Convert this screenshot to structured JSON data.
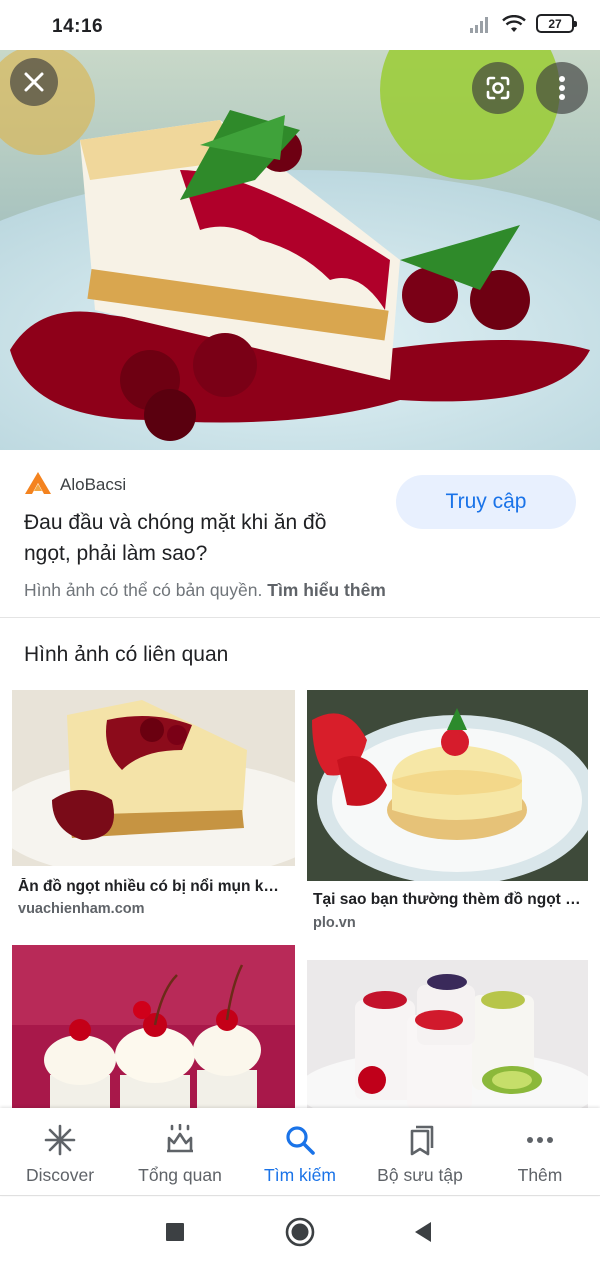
{
  "status_bar": {
    "time": "14:16",
    "battery": "27",
    "icons": [
      "signal-icon",
      "wifi-icon",
      "battery-icon"
    ]
  },
  "hero": {
    "icons": [
      "close-icon",
      "lens-icon",
      "more-vert-icon"
    ]
  },
  "source": {
    "site_name": "AloBacsi",
    "visit_label": "Truy cập",
    "title": "Đau đầu và chóng mặt khi ăn đồ ngọt, phải làm sao?",
    "copyright_text": "Hình ảnh có thể có bản quyền.",
    "learn_more": "Tìm hiểu thêm"
  },
  "related": {
    "heading": "Hình ảnh có liên quan",
    "items": [
      {
        "caption": "Ăn đồ ngọt nhiều có bị nổi mụn không?",
        "source": "vuachienham.com"
      },
      {
        "caption": "Tại sao bạn thường thèm đồ ngọt sau bữa ăn?",
        "source": "plo.vn"
      },
      {
        "caption": "",
        "source": ""
      },
      {
        "caption": "",
        "source": ""
      }
    ]
  },
  "bottom_nav": {
    "items": [
      {
        "label": "Discover",
        "icon": "asterisk-icon"
      },
      {
        "label": "Tổng quan",
        "icon": "crown-icon"
      },
      {
        "label": "Tìm kiếm",
        "icon": "search-icon",
        "active": true
      },
      {
        "label": "Bộ sưu tập",
        "icon": "collections-icon"
      },
      {
        "label": "Thêm",
        "icon": "more-horiz-icon"
      }
    ]
  },
  "colors": {
    "accent": "#1a73e8",
    "visit_button_bg": "#e8f0fe",
    "text_primary": "#202124",
    "text_secondary": "#70757a"
  }
}
